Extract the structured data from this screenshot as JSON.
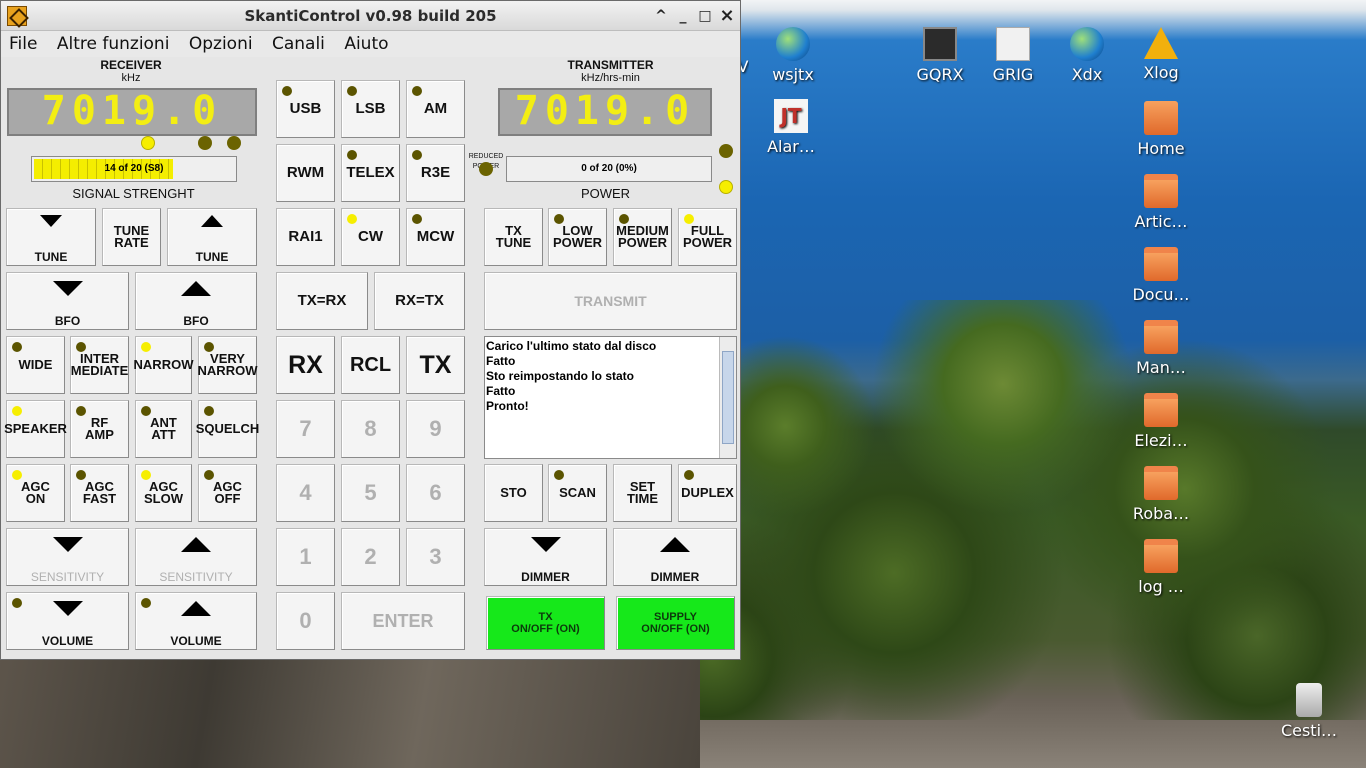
{
  "window": {
    "title": "SkantiControl v0.98 build 205",
    "controls": {
      "minimize_up": "^",
      "minimize": "_",
      "maximize": "□",
      "close": "×"
    }
  },
  "menu": [
    "File",
    "Altre funzioni",
    "Opzioni",
    "Canali",
    "Aiuto"
  ],
  "receiver": {
    "title": "RECEIVER",
    "unit": "kHz",
    "frequency": "7019.0",
    "meter_text": "14 of 20 (S8)",
    "meter_value": 14,
    "meter_max": 20,
    "caption": "SIGNAL STRENGHT"
  },
  "transmitter": {
    "title": "TRANSMITTER",
    "unit": "kHz/hrs-min",
    "frequency": "7019.0",
    "reduced_power_label": "REDUCED\nPOWER",
    "meter_text": "0 of 20 (0%)",
    "meter_value": 0,
    "meter_max": 20,
    "caption": "POWER"
  },
  "buttons": {
    "tune_down": "TUNE",
    "tune_rate": "TUNE\nRATE",
    "tune_up": "TUNE",
    "bfo_down": "BFO",
    "bfo_up": "BFO",
    "wide": "WIDE",
    "intermediate": "INTER\nMEDIATE",
    "narrow": "NARROW",
    "very_narrow": "VERY\nNARROW",
    "speaker": "SPEAKER",
    "rf_amp": "RF\nAMP",
    "ant_att": "ANT\nATT",
    "squelch": "SQUELCH",
    "agc_on": "AGC\nON",
    "agc_fast": "AGC\nFAST",
    "agc_slow": "AGC\nSLOW",
    "agc_off": "AGC\nOFF",
    "sensitivity_down": "SENSITIVITY",
    "sensitivity_up": "SENSITIVITY",
    "volume_down": "VOLUME",
    "volume_up": "VOLUME",
    "usb": "USB",
    "lsb": "LSB",
    "am": "AM",
    "rwm": "RWM",
    "telex": "TELEX",
    "r3e": "R3E",
    "rai1": "RAI1",
    "cw": "CW",
    "mcw": "MCW",
    "tx_eq_rx": "TX=RX",
    "rx_eq_tx": "RX=TX",
    "rx": "RX",
    "rcl": "RCL",
    "tx": "TX",
    "k7": "7",
    "k8": "8",
    "k9": "9",
    "k4": "4",
    "k5": "5",
    "k6": "6",
    "k1": "1",
    "k2": "2",
    "k3": "3",
    "k0": "0",
    "enter": "ENTER",
    "tx_tune": "TX\nTUNE",
    "low_power": "LOW\nPOWER",
    "medium_power": "MEDIUM\nPOWER",
    "full_power": "FULL\nPOWER",
    "transmit": "TRANSMIT",
    "sto": "STO",
    "scan": "SCAN",
    "set_time": "SET\nTIME",
    "duplex": "DUPLEX",
    "dimmer_down": "DIMMER",
    "dimmer_up": "DIMMER",
    "tx_onoff": "TX\nON/OFF (ON)",
    "supply_onoff": "SUPPLY\nON/OFF (ON)"
  },
  "log": [
    "Carico l'ultimo stato dal disco",
    "Fatto",
    "Sto reimpostando lo stato",
    "Fatto",
    "Pronto!"
  ],
  "colors": {
    "led_on": "#f6ee00",
    "led_off": "#5b5400",
    "display_text": "#f3ee13",
    "display_bg": "#a8a8a8",
    "switch_on": "#16e81a"
  },
  "desktop": {
    "icons": [
      {
        "label": "wsjtx",
        "icon": "globe-icon"
      },
      {
        "label": "GQRX",
        "icon": "gqrx-icon"
      },
      {
        "label": "GRIG",
        "icon": "grig-icon"
      },
      {
        "label": "Xdx",
        "icon": "globe-icon"
      },
      {
        "label": "Xlog",
        "icon": "xlog-icon"
      },
      {
        "label": "Alar…",
        "icon": "jt-icon"
      },
      {
        "label": "Home",
        "icon": "home-folder-icon"
      },
      {
        "label": "Artic…",
        "icon": "folder-icon"
      },
      {
        "label": "Docu…",
        "icon": "folder-icon"
      },
      {
        "label": "Man…",
        "icon": "folder-icon"
      },
      {
        "label": "Elezi…",
        "icon": "folder-icon"
      },
      {
        "label": "Roba…",
        "icon": "folder-icon"
      },
      {
        "label": "log …",
        "icon": "folder-icon"
      },
      {
        "label": "Cesti…",
        "icon": "trash-icon"
      }
    ],
    "partial_label": "V"
  }
}
